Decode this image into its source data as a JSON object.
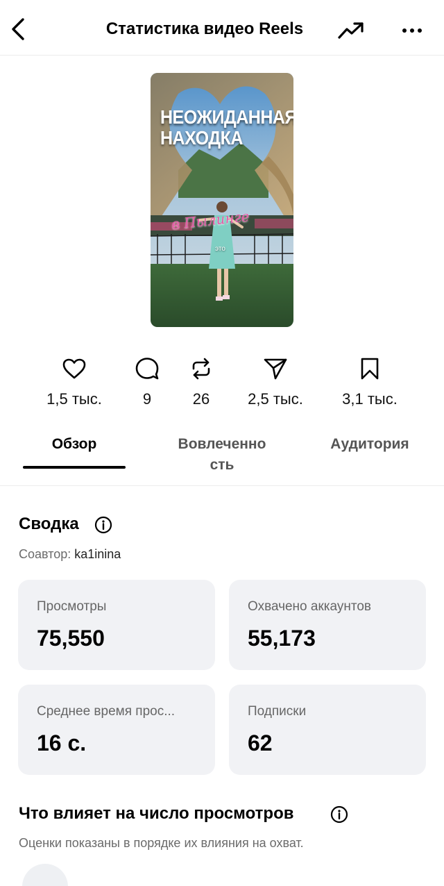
{
  "header": {
    "title": "Статистика видео Reels",
    "back_icon": "chevron-left-icon",
    "trend_icon": "trending-up-icon",
    "more_icon": "more-horizontal-icon"
  },
  "thumbnail": {
    "title_line1": "НЕОЖИДАННАЯ",
    "title_line2": "НАХОДКА",
    "subtitle": "в Пылинге",
    "caption": "это"
  },
  "metrics": [
    {
      "icon": "heart-icon",
      "value": "1,5 тыс."
    },
    {
      "icon": "comment-icon",
      "value": "9"
    },
    {
      "icon": "repost-icon",
      "value": "26"
    },
    {
      "icon": "share-icon",
      "value": "2,5 тыс."
    },
    {
      "icon": "bookmark-icon",
      "value": "3,1 тыс."
    }
  ],
  "tabs": [
    {
      "label": "Обзор",
      "active": true
    },
    {
      "label": "Вовлеченно\nсть",
      "active": false
    },
    {
      "label": "Аудитория",
      "active": false
    }
  ],
  "summary": {
    "title": "Сводка",
    "coauthor_label": "Соавтор: ",
    "coauthor_name": "ka1inina"
  },
  "cards": [
    {
      "label": "Просмотры",
      "value": "75,550"
    },
    {
      "label": "Охвачено аккаунтов",
      "value": "55,173"
    },
    {
      "label": "Среднее время прос...",
      "value": "16 с."
    },
    {
      "label": "Подписки",
      "value": "62"
    }
  ],
  "influence": {
    "title": "Что влияет на число просмотров",
    "note": "Оценки показаны в порядке их влияния на охват."
  }
}
